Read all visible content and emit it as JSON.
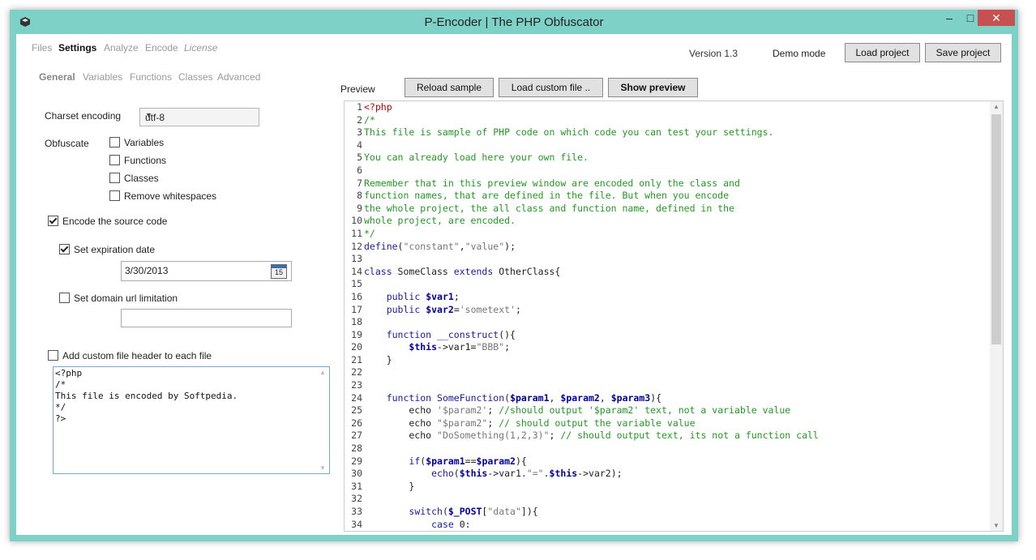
{
  "window": {
    "title": "P-Encoder | The PHP Obfuscator"
  },
  "menu": {
    "files": "Files",
    "settings": "Settings",
    "analyze": "Analyze",
    "encode": "Encode",
    "license": "License"
  },
  "top": {
    "version": "Version 1.3",
    "mode": "Demo mode",
    "load_project": "Load project",
    "save_project": "Save project"
  },
  "subtabs": {
    "general": "General",
    "variables": "Variables",
    "functions": "Functions",
    "classes": "Classes",
    "advanced": "Advanced"
  },
  "settings": {
    "charset_label": "Charset encoding",
    "charset_value": "utf-8",
    "obfuscate_label": "Obfuscate",
    "opt_variables": "Variables",
    "opt_functions": "Functions",
    "opt_classes": "Classes",
    "opt_whitespace": "Remove whitespaces",
    "encode_source": "Encode the source code",
    "set_expiration": "Set expiration date",
    "expiration_value": "3/30/2013",
    "calendar_day": "15",
    "set_domain": "Set domain url limitation",
    "domain_value": "",
    "add_header": "Add custom file header to each file",
    "header_text": "<?php\n/*\nThis file is encoded by Softpedia.\n*/\n?>"
  },
  "preview": {
    "label": "Preview",
    "reload": "Reload sample",
    "load_custom": "Load custom file ..",
    "show": "Show preview"
  },
  "code_lines": [
    [
      [
        "php",
        "<?php"
      ]
    ],
    [
      [
        "c",
        "/*"
      ]
    ],
    [
      [
        "c",
        "This file is sample of PHP code on which code you can test your settings."
      ]
    ],
    [],
    [
      [
        "c",
        "You can already load here your own file."
      ]
    ],
    [],
    [
      [
        "c",
        "Remember that in this preview window are encoded only the class and"
      ]
    ],
    [
      [
        "c",
        "function names, that are defined in the file. But when you encode"
      ]
    ],
    [
      [
        "c",
        "the whole project, the all class and function name, defined in the"
      ]
    ],
    [
      [
        "c",
        "whole project, are encoded."
      ]
    ],
    [
      [
        "c",
        "*/"
      ]
    ],
    [
      [
        "k",
        "define"
      ],
      [
        "t",
        "("
      ],
      [
        "s",
        "\"constant\""
      ],
      [
        "t",
        ","
      ],
      [
        "s",
        "\"value\""
      ],
      [
        "t",
        ");"
      ]
    ],
    [],
    [
      [
        "k",
        "class"
      ],
      [
        "t",
        " SomeClass "
      ],
      [
        "k",
        "extends"
      ],
      [
        "t",
        " OtherClass{"
      ]
    ],
    [],
    [
      [
        "t",
        "    "
      ],
      [
        "k",
        "public"
      ],
      [
        "t",
        " "
      ],
      [
        "v",
        "$var1"
      ],
      [
        "t",
        ";"
      ]
    ],
    [
      [
        "t",
        "    "
      ],
      [
        "k",
        "public"
      ],
      [
        "t",
        " "
      ],
      [
        "v",
        "$var2"
      ],
      [
        "t",
        "="
      ],
      [
        "s",
        "'sometext'"
      ],
      [
        "t",
        ";"
      ]
    ],
    [],
    [
      [
        "t",
        "    "
      ],
      [
        "k",
        "function"
      ],
      [
        "t",
        " "
      ],
      [
        "k",
        "__construct"
      ],
      [
        "t",
        "(){"
      ]
    ],
    [
      [
        "t",
        "        "
      ],
      [
        "v",
        "$this"
      ],
      [
        "t",
        "->var1="
      ],
      [
        "s",
        "\"BBB\""
      ],
      [
        "t",
        ";"
      ]
    ],
    [
      [
        "t",
        "    }"
      ]
    ],
    [],
    [],
    [
      [
        "t",
        "    "
      ],
      [
        "k",
        "function"
      ],
      [
        "t",
        " "
      ],
      [
        "k",
        "SomeFunction"
      ],
      [
        "t",
        "("
      ],
      [
        "v",
        "$param1"
      ],
      [
        "t",
        ", "
      ],
      [
        "v",
        "$param2"
      ],
      [
        "t",
        ", "
      ],
      [
        "v",
        "$param3"
      ],
      [
        "t",
        "){"
      ]
    ],
    [
      [
        "t",
        "        echo "
      ],
      [
        "s",
        "'$param2'"
      ],
      [
        "t",
        "; "
      ],
      [
        "c",
        "//should output '$param2' text, not a variable value"
      ]
    ],
    [
      [
        "t",
        "        echo "
      ],
      [
        "s",
        "\"$param2\""
      ],
      [
        "t",
        "; "
      ],
      [
        "c",
        "// should output the variable value"
      ]
    ],
    [
      [
        "t",
        "        echo "
      ],
      [
        "s",
        "\"DoSomething(1,2,3)\""
      ],
      [
        "t",
        "; "
      ],
      [
        "c",
        "// should output text, its not a function call"
      ]
    ],
    [],
    [
      [
        "t",
        "        "
      ],
      [
        "k",
        "if"
      ],
      [
        "t",
        "("
      ],
      [
        "v",
        "$param1"
      ],
      [
        "t",
        "=="
      ],
      [
        "v",
        "$param2"
      ],
      [
        "t",
        "){"
      ]
    ],
    [
      [
        "t",
        "            "
      ],
      [
        "k",
        "echo"
      ],
      [
        "t",
        "("
      ],
      [
        "v",
        "$this"
      ],
      [
        "t",
        "->var1."
      ],
      [
        "s",
        "\"=\""
      ],
      [
        "t",
        "."
      ],
      [
        "v",
        "$this"
      ],
      [
        "t",
        "->var2);"
      ]
    ],
    [
      [
        "t",
        "        }"
      ]
    ],
    [],
    [
      [
        "t",
        "        "
      ],
      [
        "k",
        "switch"
      ],
      [
        "t",
        "("
      ],
      [
        "v",
        "$_POST"
      ],
      [
        "t",
        "["
      ],
      [
        "s",
        "\"data\""
      ],
      [
        "t",
        "]){"
      ]
    ],
    [
      [
        "t",
        "            "
      ],
      [
        "k",
        "case"
      ],
      [
        "t",
        " 0:"
      ]
    ]
  ]
}
